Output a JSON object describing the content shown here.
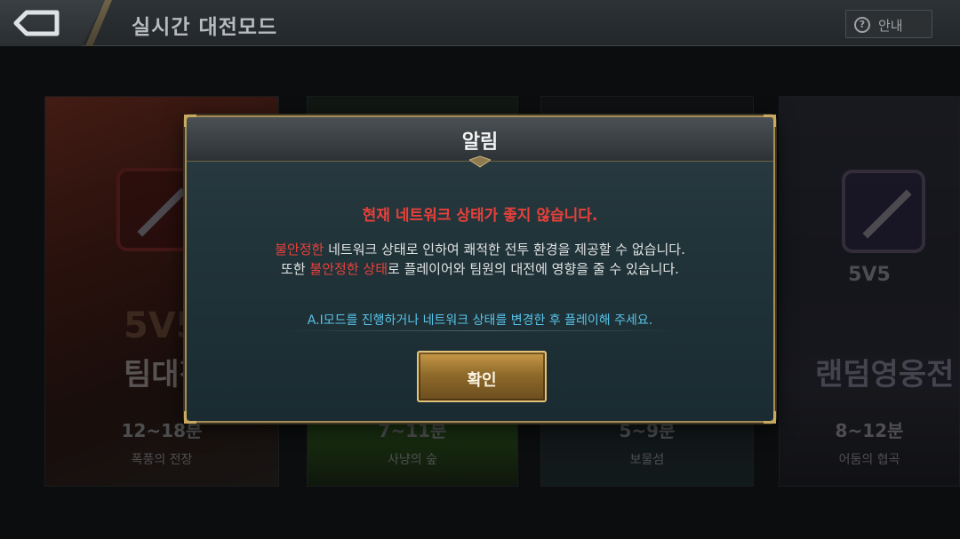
{
  "topbar": {
    "title": "실시간 대전모드",
    "help_label": "안내",
    "help_icon_glyph": "?"
  },
  "cards": [
    {
      "mode": "5V5",
      "name": "팀대전",
      "time": "12~18분",
      "map": "폭풍의 전장"
    },
    {
      "mode": "",
      "name": "",
      "time": "7~11분",
      "map": "사냥의 숲"
    },
    {
      "mode": "",
      "name": "",
      "time": "5~9분",
      "map": "보물섬"
    },
    {
      "mode": "5V5",
      "name": "랜덤영웅전",
      "time": "8~12분",
      "map": "어둠의 협곡"
    }
  ],
  "dialog": {
    "title": "알림",
    "headline": "현재 네트워크 상태가 좋지 않습니다.",
    "line1_hl": "불안정한",
    "line1_rest": " 네트워크 상태로 인하여 쾌적한 전투 환경을 제공할 수 없습니다.",
    "line2_pre": "또한 ",
    "line2_hl": "불안정한 상태",
    "line2_rest": "로 플레이어와 팀원의 대전에 영향을 줄 수 있습니다.",
    "hint": "A.I모드를 진행하거나 네트워크 상태를 변경한 후 플레이해 주세요.",
    "confirm_label": "확인"
  },
  "colors": {
    "warning_red": "#e8403a",
    "hint_blue": "#59c3e8",
    "gold_accent": "#c8a95f"
  },
  "icons": {
    "back": "back-arrow-icon",
    "help": "question-circle-icon"
  }
}
